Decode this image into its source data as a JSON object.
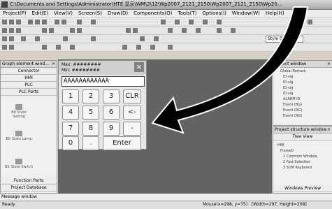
{
  "window": {
    "title": "C:\\Documents and Settings\\Administrator\\HTE 显示\\WM\\2\\12\\Wp2007_2121_2150\\Wp2007_2121_2150\\Wp20..."
  },
  "menu": [
    "Project(P)",
    "Edit(E)",
    "View(V)",
    "Screen(S)",
    "Draw(D)",
    "Components(O)",
    "Tools(T)",
    "Options(I)",
    "Window(W)",
    "Help(H)"
  ],
  "toolbar": {
    "style_combo": "Style 0"
  },
  "left_panel": {
    "title": "Graph element wind...",
    "categories": [
      "Connector",
      "HMI",
      "PLC",
      "PLC Parts"
    ],
    "items": [
      "Bit State Setting",
      "Bit State Lamp",
      "Bit State Switch"
    ],
    "footer_tabs": [
      "Function Parts",
      "Project Database"
    ]
  },
  "keypad": {
    "max_label": "Max: ########",
    "min_label": "Min: ########",
    "close": "×",
    "display": "AAAAAAAAAAAA",
    "keys": [
      "1",
      "2",
      "3",
      "CLR",
      "4",
      "5",
      "6",
      "<-",
      "7",
      "8",
      "9",
      "-",
      "0",
      ".",
      "Enter"
    ]
  },
  "right_panel": {
    "top_title": "Project window",
    "top_items": [
      "Global Remark",
      "ID-sig",
      "ID-sig",
      "ID-sig",
      "ID-sig",
      "ALARM ID",
      "Event (BG)",
      "Event (RG)",
      "Event (RG)"
    ],
    "mid_title": "Project structure window",
    "tree_view": "Tree View",
    "tree_items": [
      "HMI",
      "Frame0",
      "1 Common Window",
      "2 Fast Selection",
      "3 SUM Keyboard"
    ],
    "bottom_tab": "Windows Preview"
  },
  "message": "Message window",
  "status": {
    "ready": "Ready",
    "mouse": "Mouse(x=298, y=75)",
    "size": "[Width=297, Height=208]"
  }
}
